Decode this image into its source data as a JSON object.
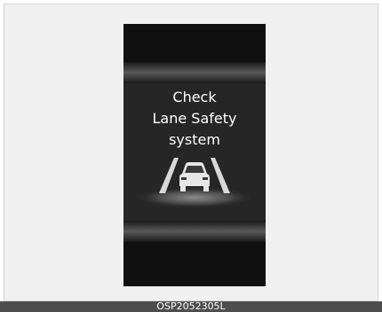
{
  "cluster": {
    "message_lines": [
      "Check",
      "Lane Safety",
      "system"
    ],
    "icon": "lane-safety-icon"
  },
  "figure": {
    "caption": "OSP2052305L"
  }
}
